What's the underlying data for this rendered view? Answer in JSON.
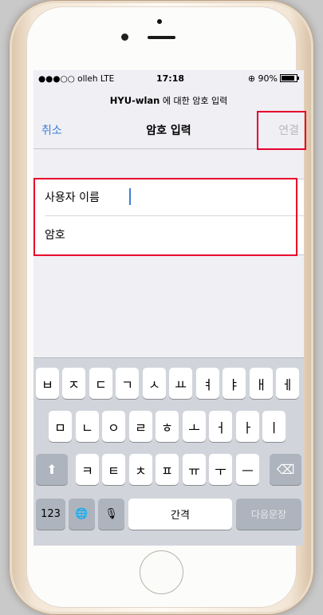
{
  "status_bar": {
    "carrier": "●●●○○ olleh  LTE",
    "time": "17:18",
    "battery": "⊕ 90%"
  },
  "subtitle": {
    "network": "HYU-wlan",
    "text": "에 대한 암호 입력"
  },
  "nav": {
    "cancel": "취소",
    "title": "암호 입력",
    "connect": "연결"
  },
  "fields": {
    "username_label": "사용자 이름",
    "password_label": "암호"
  },
  "keyboard": {
    "row1": [
      "ㅂ",
      "ㅈ",
      "ㄷ",
      "ㄱ",
      "ㅅ",
      "ㅛ",
      "ㅕ",
      "ㅑ",
      "ㅐ",
      "ㅔ"
    ],
    "row2": [
      "ㅁ",
      "ㄴ",
      "ㅇ",
      "ㄹ",
      "ㅎ",
      "ㅗ",
      "ㅓ",
      "ㅏ",
      "ㅣ"
    ],
    "row3": [
      "ㅋ",
      "ㅌ",
      "ㅊ",
      "ㅍ",
      "ㅠ",
      "ㅜ",
      "ㅡ"
    ],
    "numbers_key": "123",
    "space_key": "간격",
    "next_key": "다음문장",
    "shift_icon": "⬆",
    "delete_icon": "⌫",
    "globe_icon": "🌐",
    "mic_icon": "🎙"
  },
  "colors": {
    "accent": "#3b7fd8",
    "highlight": "#e8002c"
  }
}
